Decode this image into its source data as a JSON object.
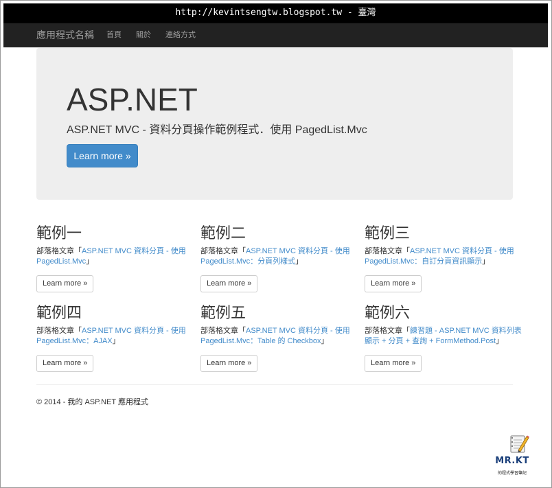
{
  "banner": {
    "text": "http://kevintsengtw.blogspot.tw - 臺灣"
  },
  "navbar": {
    "brand": "應用程式名稱",
    "links": [
      "首頁",
      "關於",
      "連絡方式"
    ]
  },
  "jumbotron": {
    "title": "ASP.NET",
    "lead": "ASP.NET MVC - 資料分頁操作範例程式．使用 PagedList.Mvc",
    "button": "Learn more »"
  },
  "examples": [
    {
      "heading": "範例一",
      "prefix": "部落格文章「",
      "link": "ASP.NET MVC 資料分頁 - 使用 PagedList.Mvc",
      "suffix": "」",
      "button": "Learn more »"
    },
    {
      "heading": "範例二",
      "prefix": "部落格文章「",
      "link": "ASP.NET MVC 資料分頁 - 使用 PagedList.Mvc：分頁列樣式",
      "suffix": "」",
      "button": "Learn more »"
    },
    {
      "heading": "範例三",
      "prefix": "部落格文章「",
      "link": "ASP.NET MVC 資料分頁 - 使用 PagedList.Mvc：自訂分頁資訊顯示",
      "suffix": "」",
      "button": "Learn more »"
    },
    {
      "heading": "範例四",
      "prefix": "部落格文章「",
      "link": "ASP.NET MVC 資料分頁 - 使用 PagedList.Mvc：AJAX",
      "suffix": "」",
      "button": "Learn more »"
    },
    {
      "heading": "範例五",
      "prefix": "部落格文章「",
      "link": "ASP.NET MVC 資料分頁 - 使用 PagedList.Mvc：Table 的 Checkbox",
      "suffix": "」",
      "button": "Learn more »"
    },
    {
      "heading": "範例六",
      "prefix": "部落格文章「",
      "link": "練習題 - ASP.NET MVC 資料列表顯示 + 分頁 + 查詢 + FormMethod.Post",
      "suffix": "」",
      "button": "Learn more »"
    }
  ],
  "footer": {
    "text": "© 2014 - 我的 ASP.NET 應用程式"
  },
  "watermark": {
    "name": "MR.KT",
    "subtitle": "的程式學習筆記",
    "icon": "notebook-pencil-icon"
  },
  "colors": {
    "primary": "#428bca",
    "navbar": "#222222",
    "jumbotron": "#eeeeee",
    "link": "#428bca"
  }
}
